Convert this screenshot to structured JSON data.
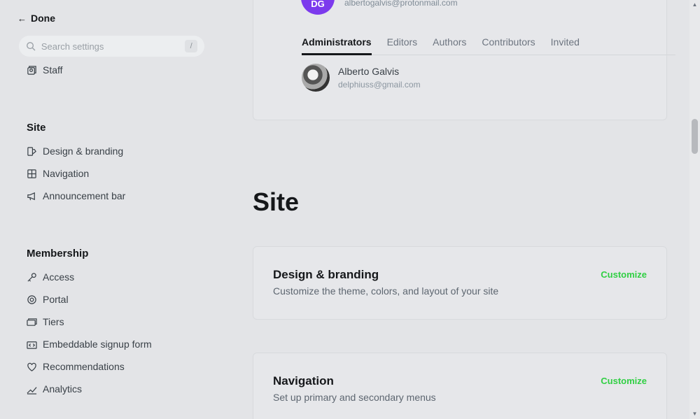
{
  "sidebar": {
    "done_label": "Done",
    "search": {
      "placeholder": "Search settings",
      "shortcut": "/"
    },
    "top_items": [
      {
        "label": "Staff",
        "icon": "staff-icon"
      }
    ],
    "sections": [
      {
        "title": "Site",
        "items": [
          {
            "label": "Design & branding",
            "icon": "paintbrush-icon"
          },
          {
            "label": "Navigation",
            "icon": "navigation-icon"
          },
          {
            "label": "Announcement bar",
            "icon": "megaphone-icon"
          }
        ]
      },
      {
        "title": "Membership",
        "items": [
          {
            "label": "Access",
            "icon": "key-icon"
          },
          {
            "label": "Portal",
            "icon": "portal-icon"
          },
          {
            "label": "Tiers",
            "icon": "tiers-icon"
          },
          {
            "label": "Embeddable signup form",
            "icon": "code-icon"
          },
          {
            "label": "Recommendations",
            "icon": "heart-icon"
          },
          {
            "label": "Analytics",
            "icon": "analytics-icon"
          }
        ]
      }
    ]
  },
  "staff_card": {
    "owner_initials": "DG",
    "owner_email": "albertogalvis@protonmail.com",
    "tabs": [
      "Administrators",
      "Editors",
      "Authors",
      "Contributors",
      "Invited"
    ],
    "active_tab": "Administrators",
    "user": {
      "name": "Alberto Galvis",
      "email": "delphiuss@gmail.com"
    }
  },
  "main": {
    "site_heading": "Site",
    "settings": [
      {
        "title": "Design & branding",
        "description": "Customize the theme, colors, and layout of your site",
        "action": "Customize"
      },
      {
        "title": "Navigation",
        "description": "Set up primary and secondary menus",
        "action": "Customize"
      }
    ]
  },
  "colors": {
    "accent_green": "#30cf43",
    "owner_avatar": "#7c3aed",
    "background": "#e3e4e7"
  }
}
